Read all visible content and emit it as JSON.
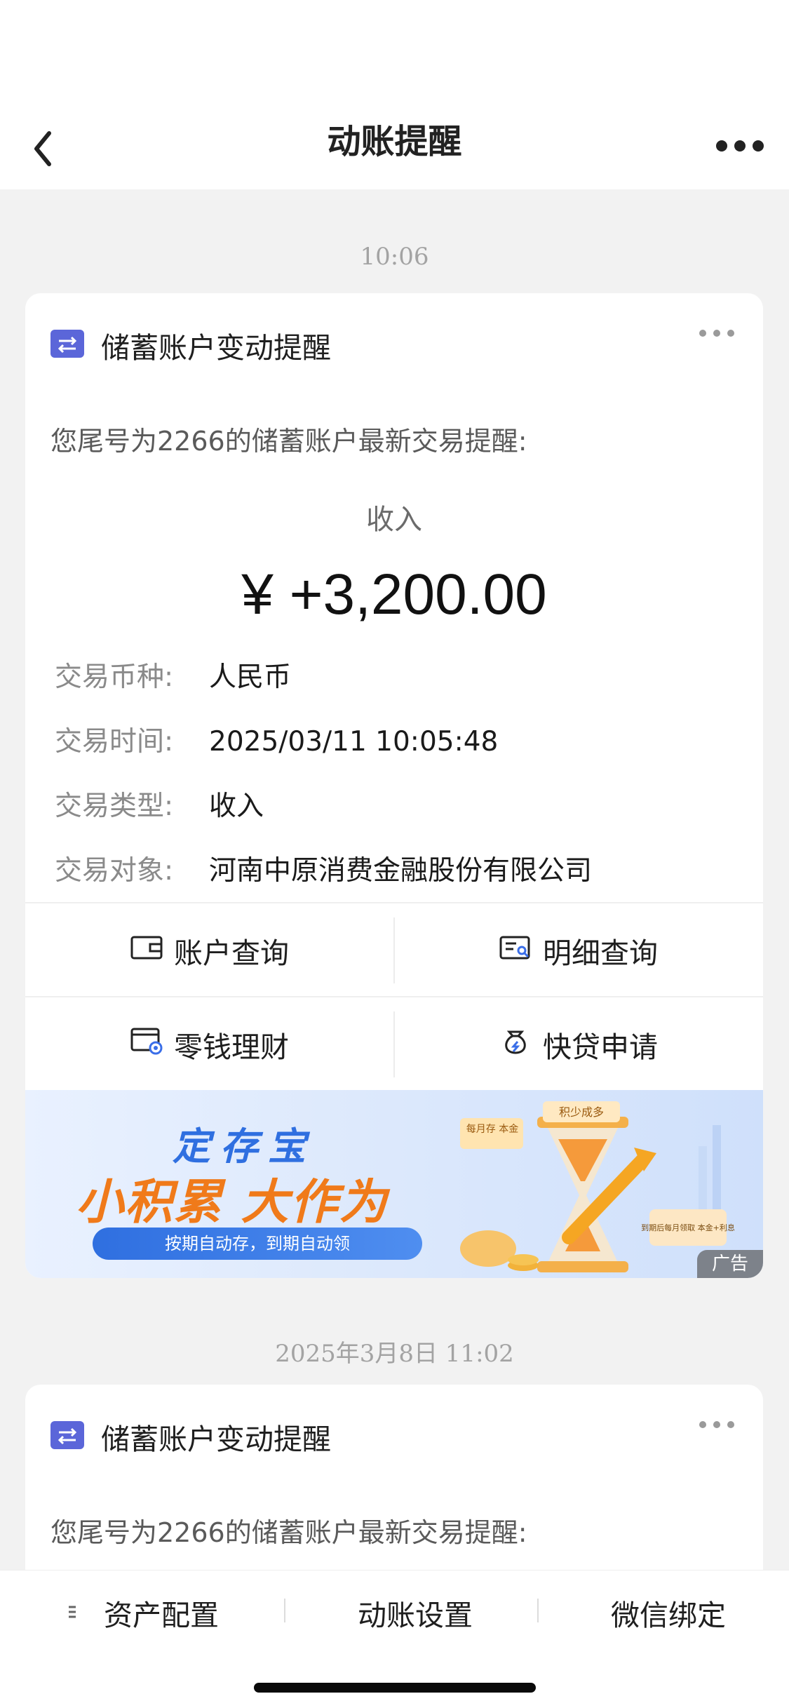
{
  "nav": {
    "title": "动账提醒",
    "back_icon": "chevron-left-icon",
    "more_icon": "more-horizontal-icon"
  },
  "messages": [
    {
      "time": "10:06",
      "card_title": "储蓄账户变动提醒",
      "intro": "您尾号为2266的储蓄账户最新交易提醒:",
      "kind": "收入",
      "amount": "¥ +3,200.00",
      "details": [
        {
          "label": "交易币种:",
          "value": "人民币"
        },
        {
          "label": "交易时间:",
          "value": "2025/03/11 10:05:48"
        },
        {
          "label": "交易类型:",
          "value": "收入"
        },
        {
          "label": "交易对象:",
          "value": "河南中原消费金融股份有限公司"
        }
      ],
      "actions": [
        {
          "label": "账户查询",
          "icon": "wallet-icon"
        },
        {
          "label": "明细查询",
          "icon": "statement-search-icon"
        },
        {
          "label": "零钱理财",
          "icon": "wealth-card-icon"
        },
        {
          "label": "快贷申请",
          "icon": "loan-bag-icon"
        }
      ],
      "banner": {
        "title1": "定存宝",
        "title2": "小积累 大作为",
        "subtitle": "按期自动存，到期自动领",
        "tag_top": "积少成多",
        "tag_left": "每月存 本金",
        "tag_right": "到期后每月领取 本金+利息",
        "ad_label": "广告"
      }
    },
    {
      "time": "2025年3月8日 11:02",
      "card_title": "储蓄账户变动提醒",
      "intro": "您尾号为2266的储蓄账户最新交易提醒:"
    }
  ],
  "bottom_tabs": [
    {
      "label": "资产配置",
      "icon": "menu-icon"
    },
    {
      "label": "动账设置"
    },
    {
      "label": "微信绑定"
    }
  ],
  "colors": {
    "accent_blue": "#5b66d9",
    "banner_orange": "#f07a1a",
    "banner_blue": "#2f6fe0"
  }
}
